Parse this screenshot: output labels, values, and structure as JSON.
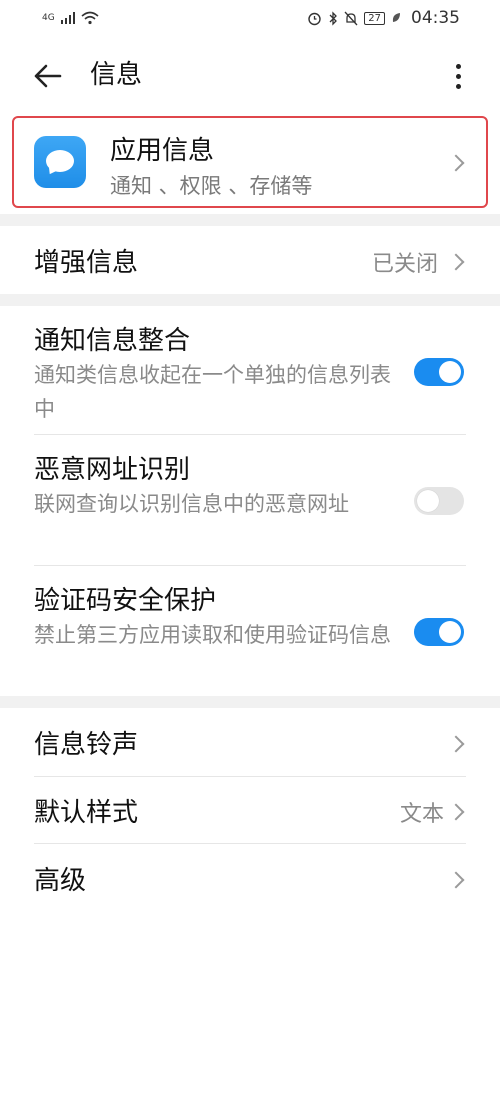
{
  "status_bar": {
    "network": "4G",
    "battery": "27",
    "time": "04:35"
  },
  "header": {
    "title": "信息"
  },
  "app_info": {
    "title": "应用信息",
    "subtitle": "通知 、权限 、存储等",
    "highlight_color": "#e0474c",
    "icon": "message-app-icon"
  },
  "enhanced": {
    "label": "增强信息",
    "value": "已关闭"
  },
  "toggles": [
    {
      "label": "通知信息整合",
      "desc": "通知类信息收起在一个单独的信息列表中",
      "on": true
    },
    {
      "label": "恶意网址识别",
      "desc": "联网查询以识别信息中的恶意网址",
      "on": false
    },
    {
      "label": "验证码安全保护",
      "desc": "禁止第三方应用读取和使用验证码信息",
      "on": true
    }
  ],
  "bottom_items": [
    {
      "label": "信息铃声",
      "value": ""
    },
    {
      "label": "默认样式",
      "value": "文本"
    },
    {
      "label": "高级",
      "value": ""
    }
  ],
  "accent_color": "#1a8cf0"
}
